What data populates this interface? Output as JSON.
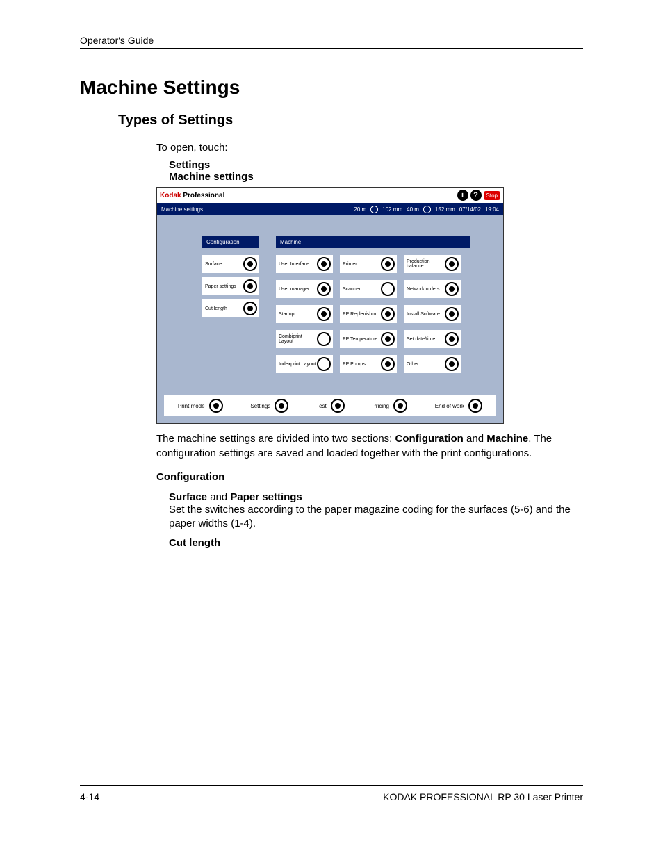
{
  "header": {
    "title": "Operator's Guide"
  },
  "headings": {
    "h1": "Machine Settings",
    "h2": "Types of Settings"
  },
  "intro": {
    "to_open": "To open, touch:",
    "settings": "Settings",
    "machine_settings": "Machine settings"
  },
  "screenshot": {
    "brand_a": "Kodak",
    "brand_b": " Professional",
    "stop": "Stop",
    "bar_title": "Machine settings",
    "status": {
      "a": "20 m",
      "b": "102 mm",
      "c": "40 m",
      "d": "152 mm",
      "date": "07/14/02",
      "time": "19:04"
    },
    "section_config": "Configuration",
    "section_machine": "Machine",
    "config_buttons": [
      "Surface",
      "Paper settings",
      "Cut length"
    ],
    "machine_grid": [
      {
        "label": "User Interface",
        "filled": true
      },
      {
        "label": "Printer",
        "filled": true
      },
      {
        "label": "Production balance",
        "filled": true
      },
      {
        "label": "User manager",
        "filled": true
      },
      {
        "label": "Scanner",
        "filled": false
      },
      {
        "label": "Network orders",
        "filled": true
      },
      {
        "label": "Startup",
        "filled": true
      },
      {
        "label": "PP Replenishm.",
        "filled": true
      },
      {
        "label": "Install Software",
        "filled": true
      },
      {
        "label": "Combiprint Layout",
        "filled": false
      },
      {
        "label": "PP Temperature",
        "filled": true
      },
      {
        "label": "Set date/time",
        "filled": true
      },
      {
        "label": "Indexprint Layout",
        "filled": false
      },
      {
        "label": "PP Pumps",
        "filled": true
      },
      {
        "label": "Other",
        "filled": true
      }
    ],
    "foot": [
      "Print mode",
      "Settings",
      "Test",
      "Pricing",
      "End of work"
    ]
  },
  "body": {
    "para1_a": "The machine settings are divided into two sections: ",
    "para1_b": "Configuration",
    "para1_c": " and ",
    "para1_d": "Machine",
    "para1_e": ". The configuration settings are saved and loaded together with the print configurations.",
    "config_h": "Configuration",
    "surf_paper_a": "Surface",
    "surf_paper_b": " and ",
    "surf_paper_c": "Paper settings",
    "surf_paper_desc": "Set the switches according to the paper magazine coding for the surfaces (5-6) and the paper widths (1-4).",
    "cut_length": "Cut length"
  },
  "footer": {
    "page": "4-14",
    "product": "KODAK PROFESSIONAL RP 30 Laser Printer"
  }
}
